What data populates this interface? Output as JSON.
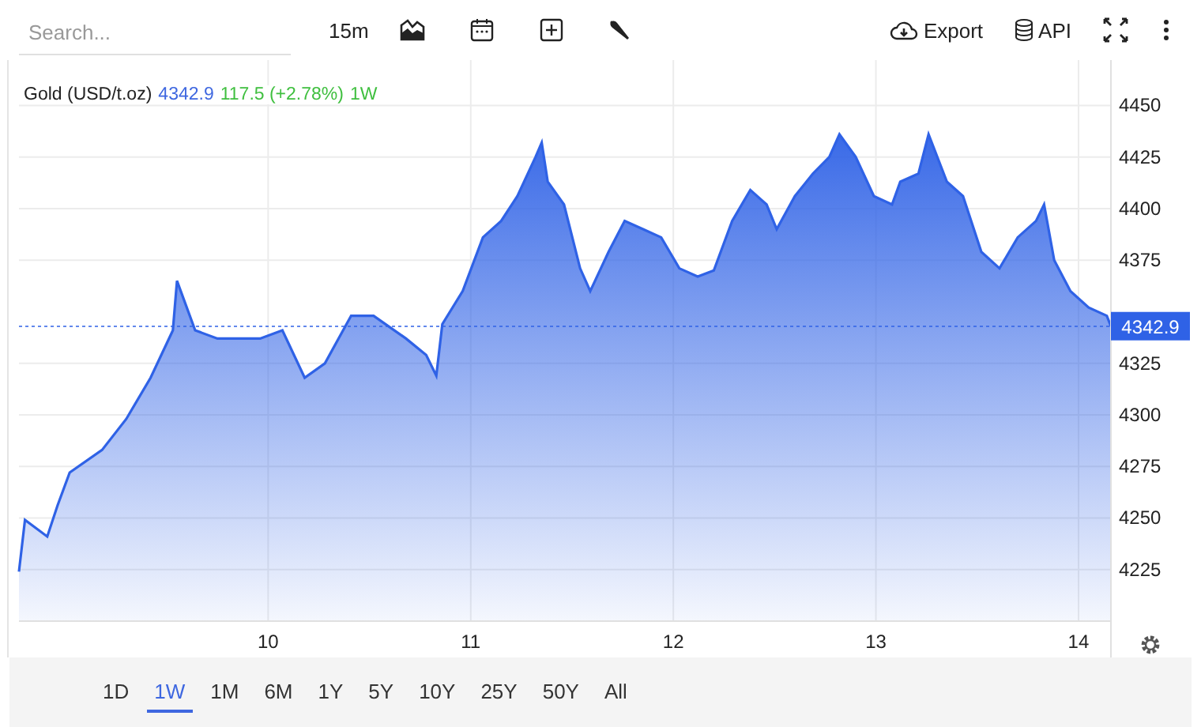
{
  "toolbar": {
    "search": {
      "placeholder": "Search..."
    },
    "interval": "15m",
    "export": "Export",
    "api": "API"
  },
  "legend": {
    "name": "Gold (USD/t.oz)",
    "price": "4342.9",
    "change": "117.5 (+2.78%)",
    "period": "1W"
  },
  "chart": {
    "price_label": "4342.9",
    "chart_data": {
      "type": "area",
      "grid": true,
      "ref_lines": [
        {
          "axis": "y",
          "value": 4342.9
        }
      ],
      "xlim": [
        8.77,
        14.16
      ],
      "ylim": [
        4200,
        4472
      ],
      "xticks": [
        10,
        11,
        12,
        13,
        14
      ],
      "yticks": [
        4225,
        4250,
        4275,
        4300,
        4325,
        4375,
        4400,
        4425,
        4450
      ],
      "x": [
        8.77,
        8.8,
        8.91,
        8.96,
        9.02,
        9.18,
        9.3,
        9.42,
        9.53,
        9.55,
        9.64,
        9.75,
        9.86,
        9.96,
        10.07,
        10.18,
        10.28,
        10.41,
        10.52,
        10.68,
        10.78,
        10.83,
        10.86,
        10.96,
        11.06,
        11.15,
        11.23,
        11.32,
        11.35,
        11.38,
        11.46,
        11.54,
        11.59,
        11.68,
        11.76,
        11.85,
        11.94,
        12.03,
        12.12,
        12.2,
        12.29,
        12.38,
        12.46,
        12.51,
        12.6,
        12.69,
        12.77,
        12.82,
        12.9,
        12.99,
        13.08,
        13.12,
        13.21,
        13.26,
        13.35,
        13.43,
        13.52,
        13.61,
        13.7,
        13.79,
        13.83,
        13.88,
        13.96,
        14.05,
        14.14,
        14.16
      ],
      "series": [
        {
          "color": "#2f62e6",
          "values": [
            4224,
            4249,
            4241,
            4256,
            4272,
            4283,
            4298,
            4318,
            4341,
            4365,
            4341,
            4337,
            4337,
            4337,
            4341,
            4318,
            4325,
            4348,
            4348,
            4337,
            4329,
            4319,
            4344,
            4360,
            4386,
            4394,
            4406,
            4425,
            4432,
            4413,
            4402,
            4371,
            4360,
            4379,
            4394,
            4390,
            4386,
            4371,
            4367,
            4370,
            4394,
            4409,
            4402,
            4390,
            4406,
            4417,
            4425,
            4436,
            4425,
            4406,
            4402,
            4413,
            4417,
            4436,
            4413,
            4406,
            4379,
            4371,
            4386,
            4394,
            4402,
            4375,
            4360,
            4352,
            4348,
            4343
          ]
        }
      ]
    }
  },
  "ranges": [
    {
      "label": "1D",
      "selected": false
    },
    {
      "label": "1W",
      "selected": true
    },
    {
      "label": "1M",
      "selected": false
    },
    {
      "label": "6M",
      "selected": false
    },
    {
      "label": "1Y",
      "selected": false
    },
    {
      "label": "5Y",
      "selected": false
    },
    {
      "label": "10Y",
      "selected": false
    },
    {
      "label": "25Y",
      "selected": false
    },
    {
      "label": "50Y",
      "selected": false
    },
    {
      "label": "All",
      "selected": false
    }
  ]
}
